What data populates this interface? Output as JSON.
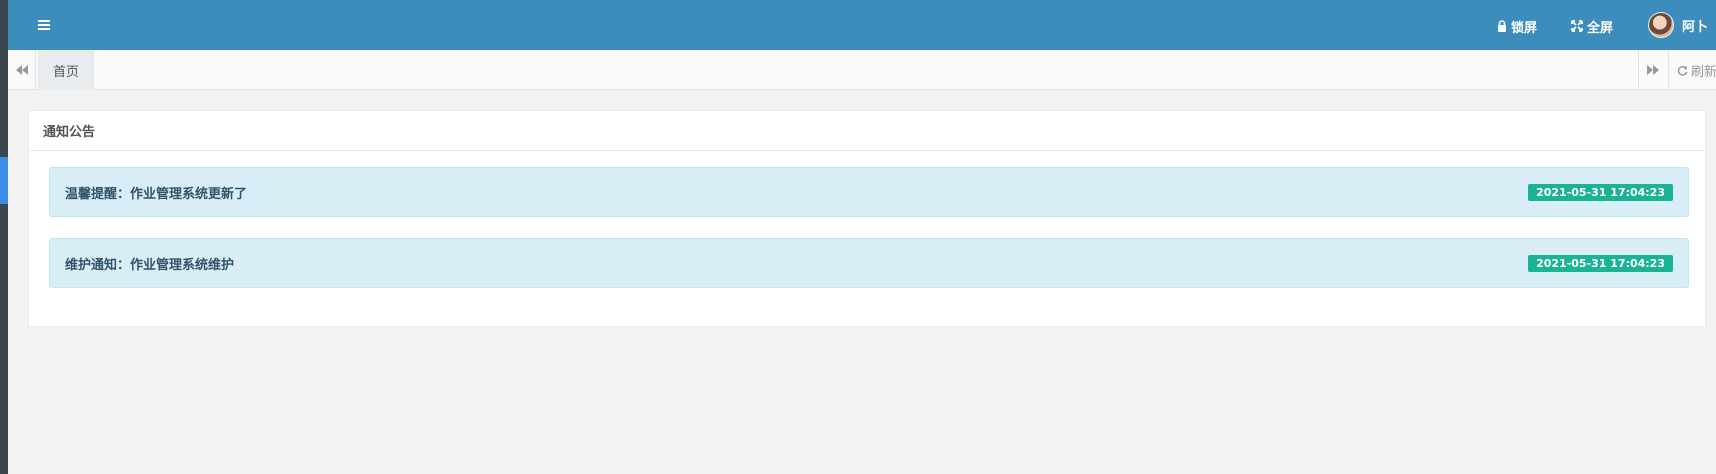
{
  "header": {
    "lock_label": "锁屏",
    "fullscreen_label": "全屏",
    "user_name": "阿卜"
  },
  "tabs": {
    "home_label": "首页",
    "refresh_label": "刷新"
  },
  "panel": {
    "title": "通知公告",
    "notices": [
      {
        "title": "温馨提醒：作业管理系统更新了",
        "time": "2021-05-31 17:04:23"
      },
      {
        "title": "维护通知：作业管理系统维护",
        "time": "2021-05-31 17:04:23"
      }
    ]
  },
  "colors": {
    "navbar": "#3c8dbc",
    "badge": "#1ab394",
    "notice_bg": "#d9edf7"
  },
  "icons": [
    "menu-icon",
    "lock-icon",
    "expand-icon",
    "double-left-icon",
    "double-right-icon",
    "refresh-icon"
  ]
}
